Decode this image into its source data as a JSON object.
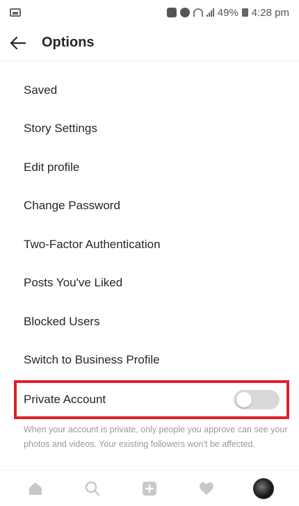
{
  "status_bar": {
    "battery_percent": "49%",
    "time": "4:28 pm",
    "icons": [
      "image-icon",
      "lock-icon",
      "alarm-icon",
      "wifi-icon",
      "signal-icon",
      "battery-icon"
    ]
  },
  "header": {
    "title": "Options",
    "back_icon": "back-arrow-icon"
  },
  "menu": {
    "items": [
      {
        "label": "Saved"
      },
      {
        "label": "Story Settings"
      },
      {
        "label": "Edit profile"
      },
      {
        "label": "Change Password"
      },
      {
        "label": "Two-Factor Authentication"
      },
      {
        "label": "Posts You've Liked"
      },
      {
        "label": "Blocked Users"
      },
      {
        "label": "Switch to Business Profile"
      }
    ]
  },
  "private_account": {
    "label": "Private Account",
    "enabled": false,
    "description": "When your account is private, only people you approve can see your photos and videos. Your existing followers won't be affected.",
    "highlight_color": "#e01f2b"
  },
  "bottom_nav": {
    "items": [
      "home-icon",
      "search-icon",
      "add-post-icon",
      "activity-heart-icon",
      "profile-avatar"
    ]
  },
  "colors": {
    "text": "#262626",
    "muted": "#999999",
    "toggle_off": "#d9d9d9"
  }
}
